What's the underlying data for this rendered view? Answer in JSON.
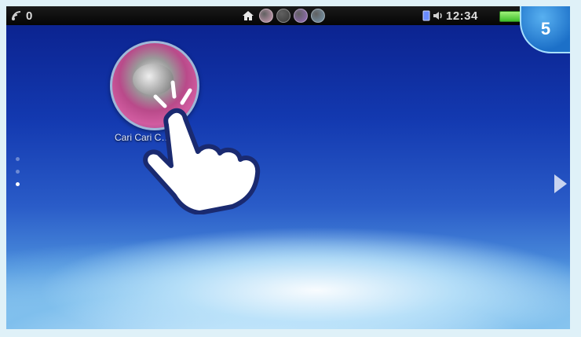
{
  "status_bar": {
    "notification_count": "0",
    "clock": "12:34",
    "icons": [
      "signal-icon",
      "home-icon",
      "app-bubble-icon",
      "app-bubble-icon",
      "app-bubble-icon",
      "app-bubble-icon",
      "sd-card-icon",
      "volume-icon",
      "battery-icon"
    ],
    "bubble_colors": [
      "#d0a0b8",
      "#3c3c3c",
      "#9c6fc0",
      "#7a9ab0"
    ],
    "battery_level": 1.0
  },
  "page_indicator": {
    "page_number": "5"
  },
  "home_screen": {
    "apps": [
      {
        "label": "Cari Cari C…n",
        "icon": "app-icon"
      }
    ],
    "page_dots": {
      "count": 3,
      "active_index": 2
    },
    "next_page_arrow": "chevron-right-icon"
  },
  "gesture_overlay": {
    "icon": "tapping-hand-icon"
  },
  "colors": {
    "accent": "#1c70c8",
    "background": "#1339b0",
    "battery": "#3fbf2a"
  }
}
